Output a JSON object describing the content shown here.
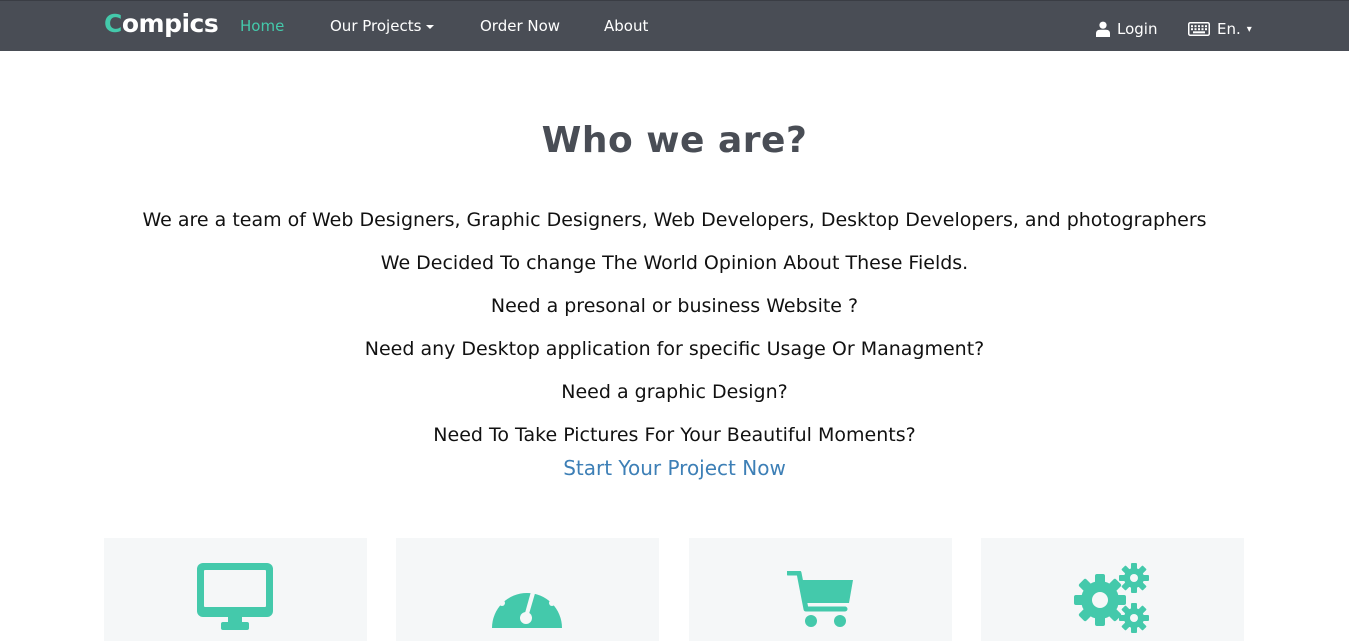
{
  "brand": {
    "first_letter": "C",
    "rest": "ompics"
  },
  "nav": {
    "home": "Home",
    "our_projects": "Our Projects",
    "order_now": "Order Now",
    "about": "About",
    "login": "Login",
    "language": "En.",
    "language_caret": "▾"
  },
  "main": {
    "title": "Who we are?",
    "lines": [
      "We are a team of Web Designers, Graphic Designers, Web Developers, Desktop Developers, and photographers",
      "We Decided To change The World Opinion About These Fields.",
      "Need a presonal or business Website ?",
      "Need any Desktop application for specific Usage Or Managment?",
      "Need a graphic Design?",
      "Need To Take Pictures For Your Beautiful Moments?"
    ],
    "cta": "Start Your Project Now"
  },
  "cards": [
    {
      "icon": "desktop-icon"
    },
    {
      "icon": "dashboard-icon"
    },
    {
      "icon": "shopping-cart-icon"
    },
    {
      "icon": "gears-icon"
    }
  ],
  "colors": {
    "navbar": "#494d55",
    "accent": "#44c9ab",
    "link": "#3d7fb6",
    "card_bg": "#f5f7f8"
  }
}
